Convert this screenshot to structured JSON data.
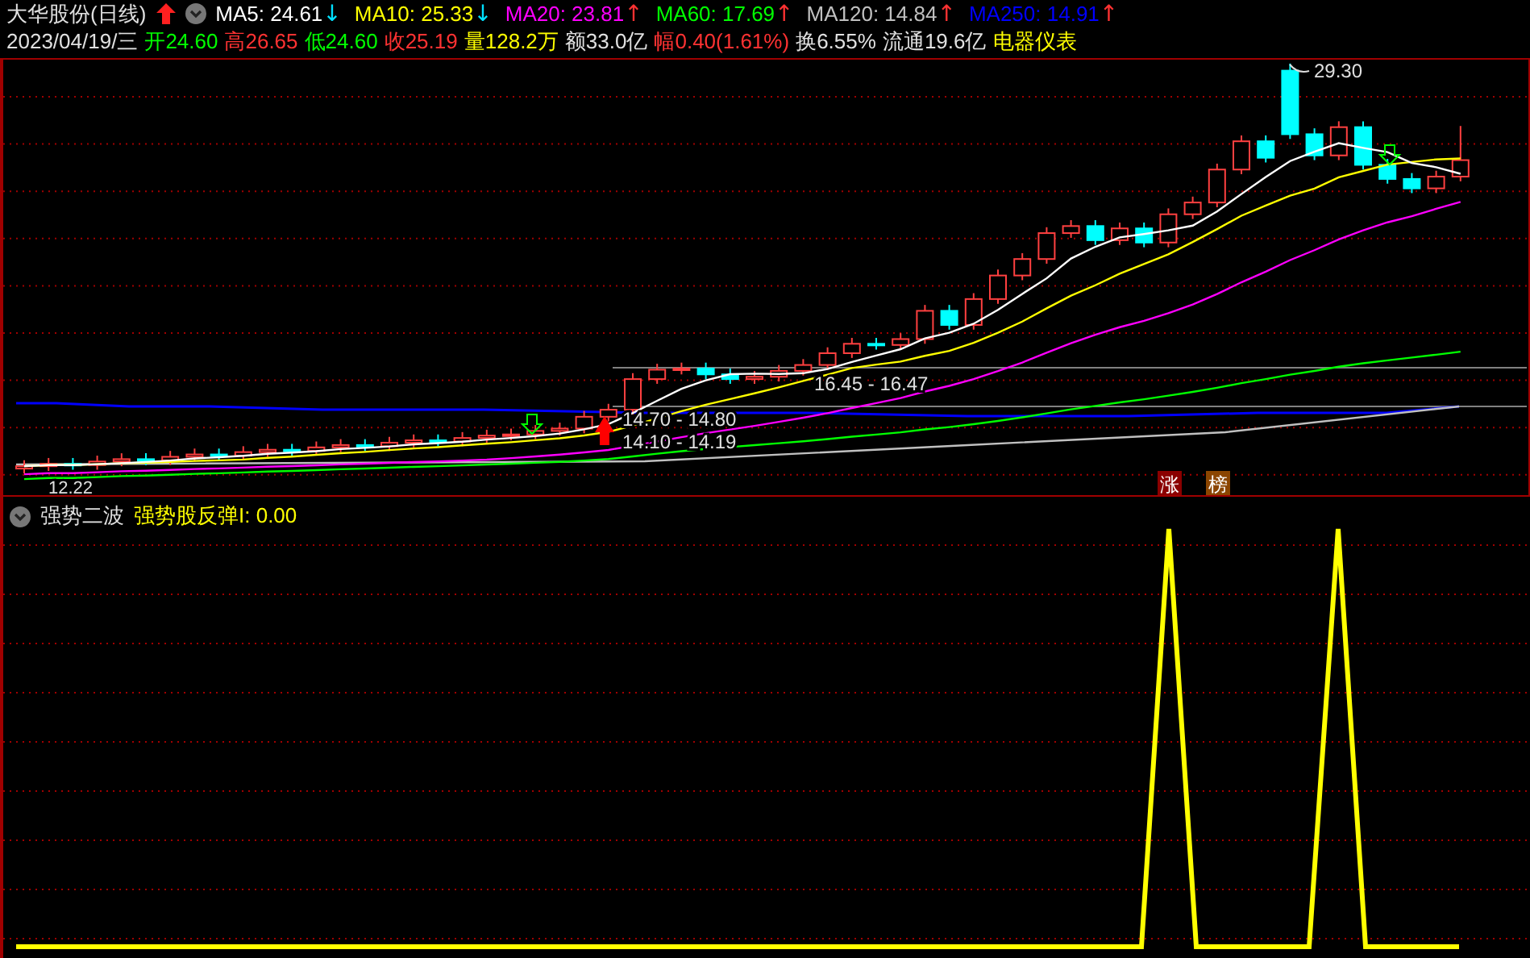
{
  "header": {
    "title": "大华股份(日线)",
    "moving_averages": [
      {
        "label": "MA5: 24.61",
        "color": "#ffffff",
        "arrow": "↓"
      },
      {
        "label": "MA10: 25.33",
        "color": "#ffff00",
        "arrow": "↓"
      },
      {
        "label": "MA20: 23.81",
        "color": "#ff00ff",
        "arrow": "↑"
      },
      {
        "label": "MA60: 17.69",
        "color": "#00ff00",
        "arrow": "↑"
      },
      {
        "label": "MA120: 14.84",
        "color": "#c0c0c0",
        "arrow": "↑"
      },
      {
        "label": "MA250: 14.91",
        "color": "#0000ff",
        "arrow": "↑"
      }
    ],
    "date": "2023/04/19/三",
    "stats": [
      {
        "label": "开",
        "value": "24.60",
        "color": "#00ff00"
      },
      {
        "label": "高",
        "value": "26.65",
        "color": "#ff3232"
      },
      {
        "label": "低",
        "value": "24.60",
        "color": "#00ff00"
      },
      {
        "label": "收",
        "value": "25.19",
        "color": "#ff3232"
      },
      {
        "label": "量",
        "value": "128.2万",
        "color": "#ffff00"
      },
      {
        "label": "额",
        "value": "33.0亿",
        "color": "#e0e0e0"
      },
      {
        "label": "幅",
        "value": "0.40(1.61%)",
        "color": "#ff3232"
      },
      {
        "label": "换",
        "value": "6.55%",
        "color": "#e0e0e0"
      },
      {
        "label": "流通",
        "value": "19.6亿",
        "color": "#e0e0e0"
      }
    ],
    "sector": "电器仪表"
  },
  "price_chart": {
    "annotations": [
      {
        "text": "29.30",
        "kind": "high"
      },
      {
        "text": "16.45 - 16.47",
        "kind": "gap"
      },
      {
        "text": "14.70 - 14.80",
        "kind": "gap"
      },
      {
        "text": "14.10 - 14.19",
        "kind": "gap"
      },
      {
        "text": "12.22",
        "kind": "low"
      }
    ],
    "tags": [
      {
        "text": "涨",
        "color": "#8b0000"
      },
      {
        "text": "榜",
        "color": "#8b4500"
      }
    ]
  },
  "indicator": {
    "name": "强势二波",
    "series_label": "强势股反弹I: 0.00"
  }
}
